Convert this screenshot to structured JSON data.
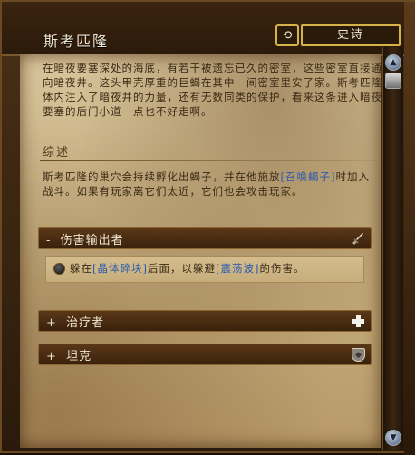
{
  "header": {
    "title": "斯考匹隆",
    "reset_glyph": "⟲",
    "difficulty": "史诗"
  },
  "intro": "在暗夜要塞深处的海底，有若干被遗忘已久的密室，这些密室直接通向暗夜井。这头甲壳厚重的巨蝎在其中一间密室里安了家。斯考匹隆体内注入了暗夜井的力量，还有无数同类的保护，看来这条进入暗夜要塞的后门小道一点也不好走啊。",
  "overview": {
    "heading": "综述",
    "text_before": "斯考匹隆的巢穴会持续孵化出蝎子，并在他施放",
    "link": "[召唤蝎子]",
    "text_after": "时加入战斗。如果有玩家离它们太近，它们也会攻击玩家。"
  },
  "roles": {
    "dps": {
      "prefix": "-",
      "label": "伤害输出者",
      "icon": "sword-icon"
    },
    "healer": {
      "prefix": "+",
      "label": "治疗者",
      "icon": "plus-icon"
    },
    "tank": {
      "prefix": "+",
      "label": "坦克",
      "icon": "shield-icon"
    }
  },
  "dps_tip": {
    "before": "躲在",
    "link1": "[晶体碎块]",
    "middle": "后面，以躲避",
    "link2": "[震荡波]",
    "after": "的伤害。"
  },
  "colors": {
    "link": "#2a5bb0",
    "parchment": "#c9b284",
    "frame": "#2a1a0b",
    "gold_border": "#d6b24a"
  }
}
